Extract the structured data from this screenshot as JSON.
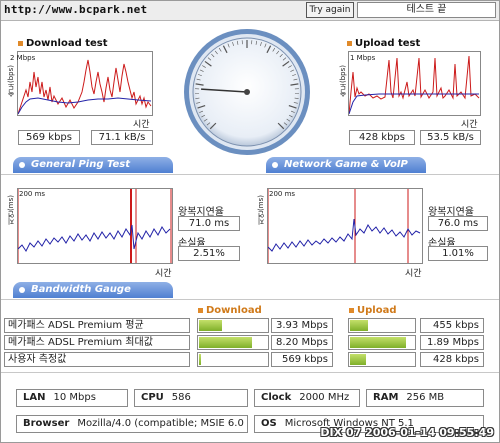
{
  "header": {
    "url": "http://www.bcpark.net",
    "try_again": "Try again",
    "status": "테스트 끝"
  },
  "download": {
    "title": "Download test",
    "y_axis": "속도(bps)",
    "max_label": "2 Mbps",
    "x_label": "시간",
    "kbps": "569 kbps",
    "kBs": "71.1 kB/s"
  },
  "upload": {
    "title": "Upload test",
    "y_axis": "속도(bps)",
    "max_label": "1 Mbps",
    "x_label": "시간",
    "kbps": "428 kbps",
    "kBs": "53.5 kB/s"
  },
  "ping": {
    "banner": "General Ping Test",
    "left": {
      "y_axis": "지연(ms)",
      "max_label": "200 ms",
      "x_label": "시간",
      "rtt_label": "왕복지연율",
      "rtt_value": "71.0 ms",
      "loss_label": "손실율",
      "loss_value": "2.51%"
    }
  },
  "game": {
    "banner": "Network Game & VoIP Test",
    "right": {
      "y_axis": "지연(ms)",
      "max_label": "200 ms",
      "x_label": "시간",
      "rtt_label": "왕복지연율",
      "rtt_value": "76.0 ms",
      "loss_label": "손실율",
      "loss_value": "1.01%"
    }
  },
  "gauge": {
    "banner": "Bandwidth Gauge",
    "needle_fraction": 0.18
  },
  "bandwidth": {
    "download_header": "Download",
    "upload_header": "Upload",
    "rows": [
      {
        "label": "메가패스 ADSL Premium 평균",
        "down_value": "3.93 Mbps",
        "down_fraction": 0.35,
        "up_value": "455 kbps",
        "up_fraction": 0.3
      },
      {
        "label": "메가패스 ADSL Premium 최대값",
        "down_value": "8.20 Mbps",
        "down_fraction": 0.78,
        "up_value": "1.89 Mbps",
        "up_fraction": 0.88
      },
      {
        "label": "사용자 측정값",
        "down_value": "569 kbps",
        "down_fraction": 0.05,
        "up_value": "428 kbps",
        "up_fraction": 0.28
      }
    ]
  },
  "system": {
    "lan_label": "LAN",
    "lan_value": "10 Mbps",
    "cpu_label": "CPU",
    "cpu_value": "586",
    "clock_label": "Clock",
    "clock_value": "2000 MHz",
    "ram_label": "RAM",
    "ram_value": "256 MB",
    "browser_label": "Browser",
    "browser_value": "Mozilla/4.0 (compatible; MSIE 6.0",
    "os_label": "OS",
    "os_value": "Microsoft Windows NT 5.1"
  },
  "stamp": "DIX 07 2006-01-14 09:55:49",
  "colors": {
    "accent_orange": "#e08a2a",
    "banner_blue": "#4f7fd1",
    "bar_green": "#8fbe34",
    "trace_red": "#cc1a1a",
    "trace_blue": "#2323a8"
  }
}
